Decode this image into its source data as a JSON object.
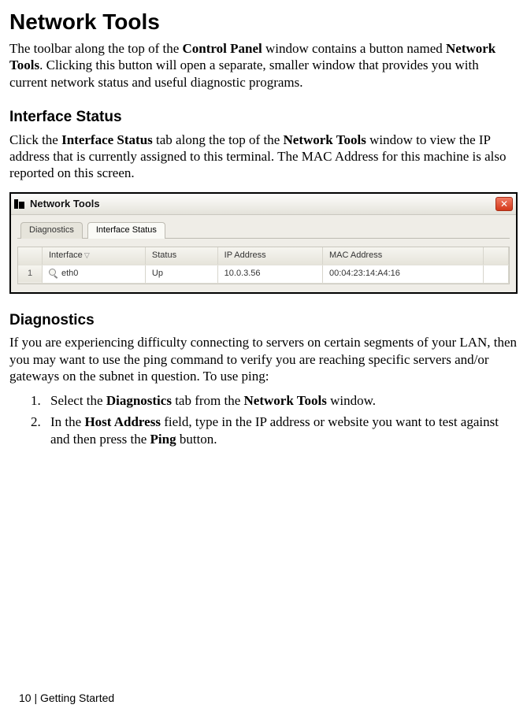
{
  "page": {
    "title": "Network Tools",
    "intro_pre": "The toolbar along the top of the ",
    "intro_b1": "Control Panel",
    "intro_mid": " window contains a button named ",
    "intro_b2": "Network Tools",
    "intro_post": ".  Clicking this button will open a separate, smaller window that provides you with current network status and useful diagnostic programs.",
    "footer": "10 | Getting Started"
  },
  "section_status": {
    "heading": "Interface Status",
    "p_pre": "Click the ",
    "p_b1": "Interface Status",
    "p_mid1": " tab along the top of the ",
    "p_b2": "Network Tools",
    "p_post": " window to view the IP address that is currently assigned to this terminal.  The MAC Address for this machine is also reported on this screen."
  },
  "win": {
    "title": "Network Tools",
    "close": "✕",
    "tabs": {
      "diag": "Diagnostics",
      "status": "Interface Status"
    },
    "cols": {
      "iface": "Interface",
      "status": "Status",
      "ip": "IP Address",
      "mac": "MAC Address"
    },
    "rows": [
      {
        "n": "1",
        "iface": "eth0",
        "status": "Up",
        "ip": "10.0.3.56",
        "mac": "00:04:23:14:A4:16"
      }
    ]
  },
  "section_diag": {
    "heading": "Diagnostics",
    "p": "If you are experiencing difficulty connecting to servers on certain segments of your LAN, then you may want to use the ping command to verify you are reaching specific servers and/or gateways on the subnet in question.  To use ping:",
    "s1_pre": "Select the ",
    "s1_b1": "Diagnostics",
    "s1_mid": " tab from the ",
    "s1_b2": "Network Tools",
    "s1_post": " window.",
    "s2_pre": "In the ",
    "s2_b1": "Host Address",
    "s2_mid": "  field, type in the IP address or website you want to test against and then press the ",
    "s2_b2": "Ping",
    "s2_post": " button."
  }
}
